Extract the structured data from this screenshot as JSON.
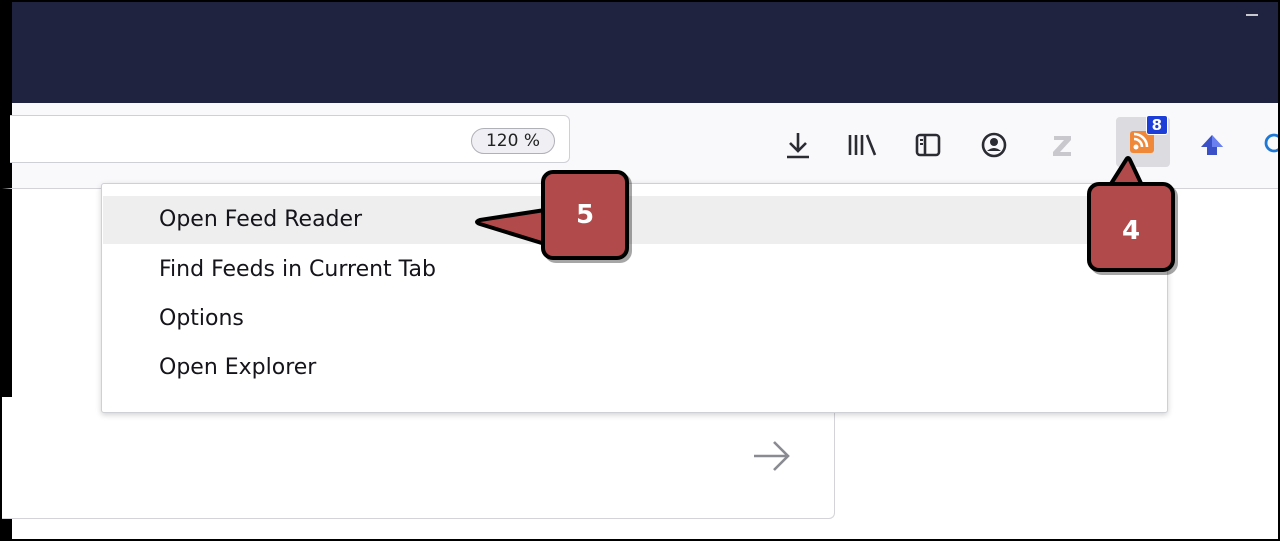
{
  "window": {
    "restore_icon": "restore-window-icon"
  },
  "urlbar": {
    "zoom_label": "120 %"
  },
  "toolbar": {
    "icons": [
      "download-icon",
      "library-icon",
      "sidebar-icon",
      "account-icon",
      "zotero-icon",
      "rss-feed-icon",
      "bookmark-up-icon",
      "search-icon"
    ],
    "rss_badge": "8"
  },
  "menu": {
    "items": [
      {
        "label": "Open Feed Reader"
      },
      {
        "label": "Find Feeds in Current Tab"
      },
      {
        "label": "Options"
      },
      {
        "label": "Open Explorer"
      }
    ]
  },
  "callouts": {
    "step_menu": "5",
    "step_button": "4"
  },
  "colors": {
    "titlebar": "#202340",
    "callout": "#b14a4a",
    "badge": "#1d3fd8"
  }
}
